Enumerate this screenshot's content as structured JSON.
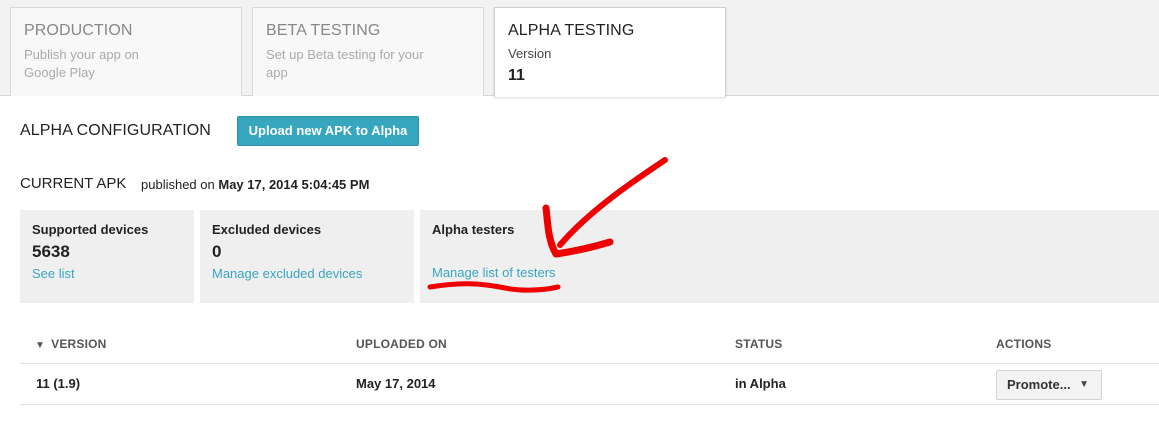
{
  "tabs": [
    {
      "title": "PRODUCTION",
      "subtitle": "Publish your app on Google Play"
    },
    {
      "title": "BETA TESTING",
      "subtitle": "Set up Beta testing for your app"
    },
    {
      "title": "ALPHA TESTING",
      "subtitle": "Version",
      "version": "11"
    }
  ],
  "config": {
    "title": "ALPHA CONFIGURATION",
    "upload_label": "Upload new APK to Alpha"
  },
  "current_apk": {
    "label": "CURRENT APK",
    "published_prefix": "published on",
    "published_date": "May 17, 2014 5:04:45 PM"
  },
  "stats": {
    "supported": {
      "label": "Supported devices",
      "count": "5638",
      "link": "See list"
    },
    "excluded": {
      "label": "Excluded devices",
      "count": "0",
      "link": "Manage excluded devices"
    },
    "testers": {
      "label": "Alpha testers",
      "link": "Manage list of testers"
    }
  },
  "table": {
    "headers": {
      "version": "VERSION",
      "uploaded": "UPLOADED ON",
      "status": "STATUS",
      "actions": "ACTIONS"
    },
    "rows": [
      {
        "version": "11 (1.9)",
        "uploaded": "May 17, 2014",
        "status": "in Alpha",
        "action": "Promote..."
      }
    ]
  },
  "icons": {
    "sort": "sort-down-icon",
    "caret": "caret-down-icon"
  },
  "colors": {
    "accent": "#37a6bf",
    "link": "#3aa6bf",
    "annotation": "#ee0000"
  }
}
